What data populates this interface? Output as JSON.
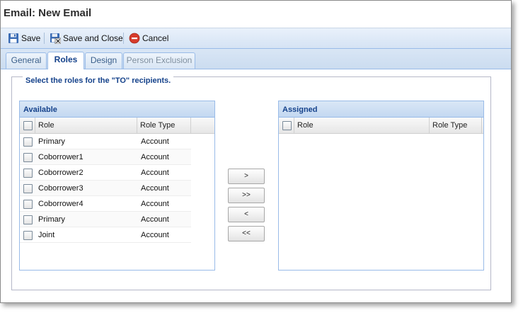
{
  "window": {
    "title": "Email: New Email"
  },
  "toolbar": {
    "save_label": "Save",
    "save_close_label": "Save and Close",
    "cancel_label": "Cancel"
  },
  "tabs": [
    {
      "label": "General",
      "state": "normal"
    },
    {
      "label": "Roles",
      "state": "active"
    },
    {
      "label": "Design",
      "state": "normal"
    },
    {
      "label": "Person Exclusion",
      "state": "disabled"
    }
  ],
  "roles": {
    "legend": "Select the roles for the \"TO\" recipients.",
    "available": {
      "title": "Available",
      "columns": [
        "Role",
        "Role Type"
      ],
      "rows": [
        {
          "role": "Primary",
          "type": "Account"
        },
        {
          "role": "Coborrower1",
          "type": "Account"
        },
        {
          "role": "Coborrower2",
          "type": "Account"
        },
        {
          "role": "Coborrower3",
          "type": "Account"
        },
        {
          "role": "Coborrower4",
          "type": "Account"
        },
        {
          "role": "Primary",
          "type": "Account"
        },
        {
          "role": "Joint",
          "type": "Account"
        }
      ]
    },
    "assigned": {
      "title": "Assigned",
      "columns": [
        "Role",
        "Role Type"
      ],
      "rows": []
    },
    "move_buttons": {
      "add_one": ">",
      "add_all": ">>",
      "remove_one": "<",
      "remove_all": "<<"
    }
  },
  "colors": {
    "header_blue": "#15428b",
    "border_blue": "#99bbe8",
    "toolbar_bg": "#d5e3f4"
  },
  "icons": {
    "save": "floppy-disk-icon",
    "save_close": "floppy-disk-close-icon",
    "cancel": "red-circle-minus-icon"
  }
}
